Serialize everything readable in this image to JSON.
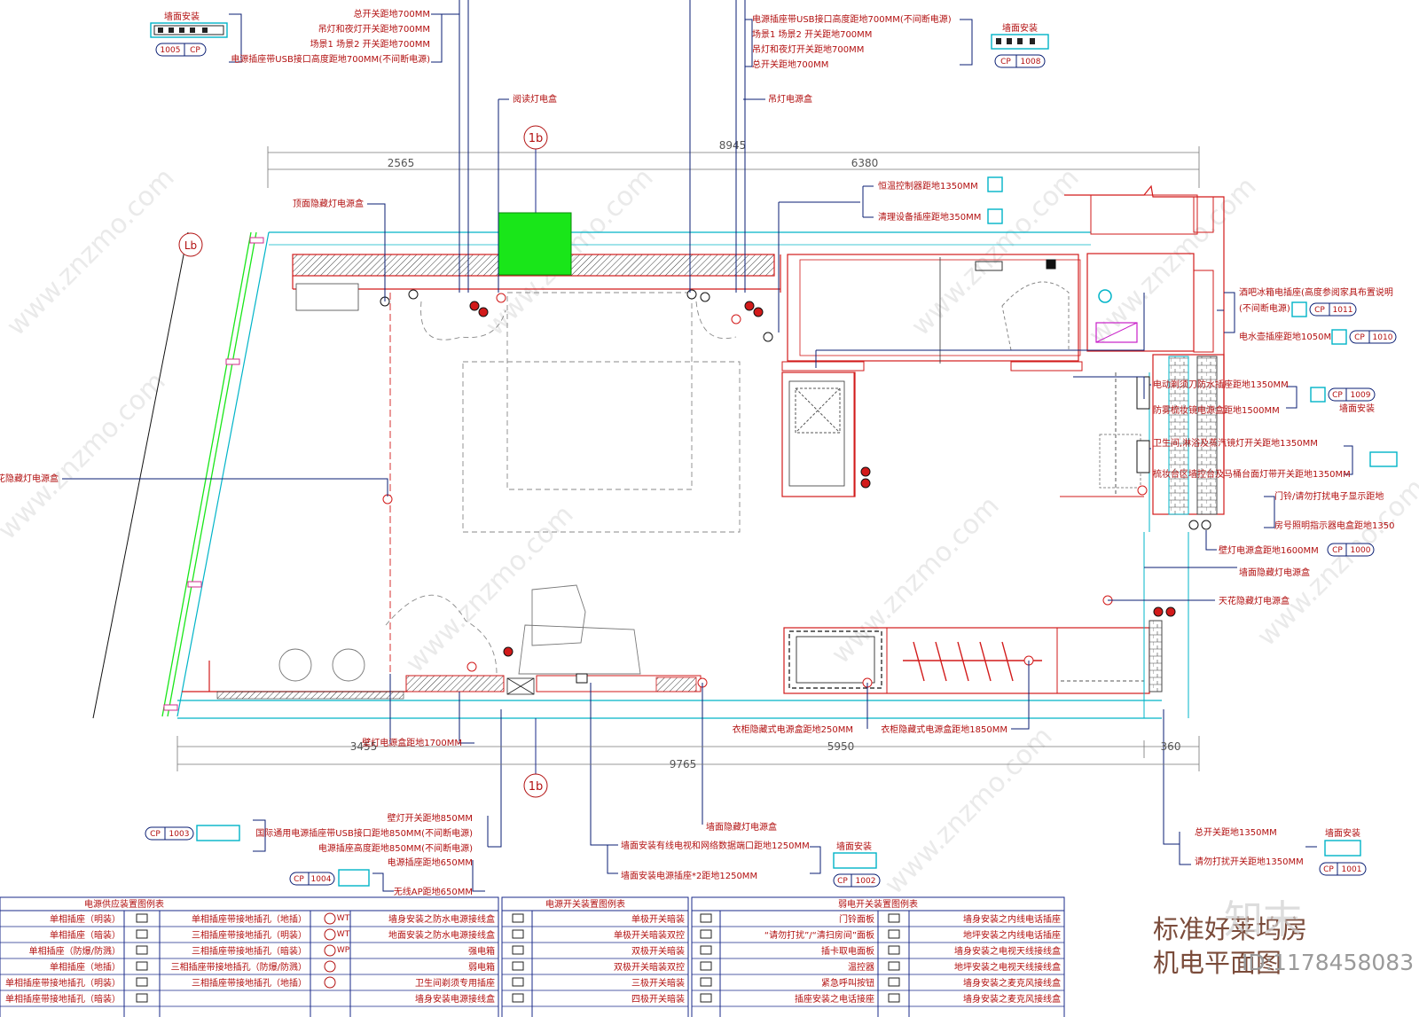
{
  "title": {
    "line1": "标准好莱坞房",
    "line2": "机电平面图",
    "watermark_id": "ID:1178458083"
  },
  "watermark": {
    "site": "www.znzmo.com",
    "brand": "知末网",
    "logo": "知末"
  },
  "callouts": {
    "tl": [
      "总开关距地700MM",
      "吊灯和夜灯开关距地700MM",
      "场景1 场景2 开关距地700MM",
      "电源插座带USB接口高度距地700MM(不间断电源)"
    ],
    "tl_install": "墙面安装",
    "tl_tag": [
      "1005",
      "CP"
    ],
    "tr": [
      "电源插座带USB接口高度距地700MM(不间断电源)",
      "场景1 场景2 开关距地700MM",
      "吊灯和夜灯开关距地700MM",
      "总开关距地700MM"
    ],
    "tr_install": "墙面安装",
    "tr_tag": [
      "CP",
      "1008"
    ],
    "reading": "阅读灯电盒",
    "pendant": "吊灯电源盒",
    "ceiling_hidden": "顶面隐藏灯电源盒",
    "left_ceiling": "天花隐藏灯电源盒",
    "thermo": "恒温控制器距地1350MM",
    "cleaning": "清理设备插座距地350MM",
    "minibar": "酒吧冰箱电插座(高度参阅家具布置说明",
    "minibar2": "(不间断电源)",
    "tag_1011": [
      "CP",
      "1011"
    ],
    "kettle": "电水壶插座距地1050MM",
    "tag_1010": [
      "CP",
      "1010"
    ],
    "shaver": "电动剃须刀防水插座距地1350MM",
    "mirror": "防雾梳妆镜电源盒距地1500MM",
    "tag_1009": [
      "CP",
      "1009"
    ],
    "wall_install_1009": "墙面安装",
    "bath_switch": "卫生间,淋浴及蒸汽镜灯开关距地1350MM",
    "vanity_switch": "梳妆台区墙控台及马桶台面灯带开关距地1350MM",
    "doorbell": "门铃/请勿打扰电子显示距地",
    "room_indicator": "房号照明指示器电盒距地1350",
    "sconce_1600": "壁灯电源盒距地1600MM",
    "tag_1000": [
      "CP",
      "1000"
    ],
    "wall_hidden_r": "墙面隐藏灯电源盒",
    "ceiling_hidden_r": "天花隐藏灯电源盒",
    "sconce_1700": "壁灯电源盒距地1700MM",
    "wardrobe_250": "衣柜隐藏式电源盒距地250MM",
    "wardrobe_1850": "衣柜隐藏式电源盒距地1850MM",
    "bl": [
      "壁灯开关距地850MM",
      "国际通用电源插座带USB接口距地850MM(不间断电源)",
      "电源插座高度距地850MM(不间断电源)"
    ],
    "tag_1003": [
      "CP",
      "1003"
    ],
    "bl2": [
      "电源插座距地650MM",
      "无线AP距地650MM"
    ],
    "tag_1004": [
      "CP",
      "1004"
    ],
    "wall_hidden_b": "墙面隐藏灯电源盒",
    "bc": [
      "墙面安装有线电视和网络数据端口距地1250MM",
      "墙面安装电源插座*2距地1250MM"
    ],
    "bc_install": "墙面安装",
    "tag_1002": [
      "CP",
      "1002"
    ],
    "br": [
      "总开关距地1350MM",
      "请勿打扰开关距地1350MM"
    ],
    "br_install": "墙面安装",
    "tag_1001": [
      "CP",
      "1001"
    ]
  },
  "dimensions": {
    "top_total": "8945",
    "top_left": "2565",
    "top_right": "6380",
    "bottom_total": "9765",
    "bottom_left": "3455",
    "bottom_mid": "5950",
    "bottom_right": "360"
  },
  "section_marks": {
    "top": "1b",
    "bottom": "1b",
    "left": "Lb"
  },
  "legend": {
    "power_header": "电源供应装置图例表",
    "switch_header": "电源开关装置图例表",
    "weak_header": "弱电开关装置图例表",
    "power_col1": [
      "单相插座（明装）",
      "单相插座（暗装）",
      "单相插座（防爆/防溅）",
      "单相插座（地插）",
      "单相插座带接地插孔（明装）",
      "单相插座带接地插孔（暗装）"
    ],
    "power_col2": [
      "单相插座带接地插孔（地插）",
      "三相插座带接地插孔（明装）",
      "三相插座带接地插孔（暗装）",
      "三相插座带接地插孔（防爆/防溅）",
      "三相插座带接地插孔（地插）"
    ],
    "power_col2_codes": [
      "WT",
      "WT",
      "WP",
      "",
      ""
    ],
    "power_col3": [
      "墙身安装之防水电源接线盒",
      "地面安装之防水电源接线盒",
      "强电箱",
      "弱电箱",
      "卫生间剃须专用插座",
      "墙身安装电源接线盒"
    ],
    "switch_col": [
      "单极开关暗装",
      "单极开关暗装双控",
      "双极开关暗装",
      "双极开关暗装双控",
      "三极开关暗装",
      "四极开关暗装"
    ],
    "weak_col1": [
      "门铃面板",
      "“请勿打扰”/“清扫房间”面板",
      "插卡取电面板",
      "温控器",
      "紧急呼叫按钮",
      "插座安装之电话接座"
    ],
    "weak_col2": [
      "墙身安装之内线电话插座",
      "地坪安装之内线电话插座",
      "墙身安装之电视天线接线盒",
      "地坪安装之电视天线接线盒",
      "墙身安装之麦克风接线盒",
      "墙身安装之麦克风接线盒"
    ]
  },
  "colors": {
    "wall": "#d21a1a",
    "cyan": "#00b4c8",
    "navy": "#0a1e73",
    "green": "#19e619",
    "hatch": "#222222"
  }
}
